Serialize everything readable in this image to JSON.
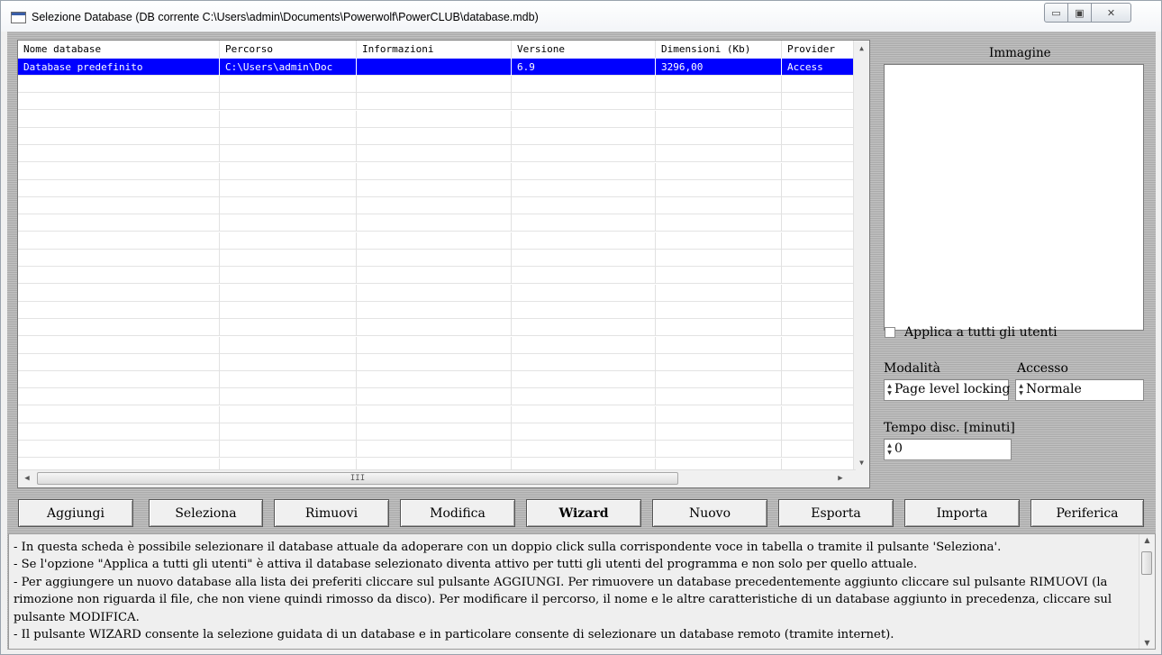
{
  "window": {
    "title": "Selezione Database (DB corrente C:\\Users\\admin\\Documents\\Powerwolf\\PowerCLUB\\database.mdb)",
    "minimize_glyph": "▭",
    "maximize_glyph": "▣",
    "close_glyph": "✕"
  },
  "grid": {
    "columns": [
      "Nome database",
      "Percorso",
      "Informazioni",
      "Versione",
      "Dimensioni (Kb)",
      "Provider"
    ],
    "rows": [
      {
        "name": "Database predefinito",
        "path": "C:\\Users\\admin\\Doc",
        "info": "",
        "version": "6.9",
        "size": "3296,00",
        "provider": "Access",
        "selected": true
      }
    ],
    "scroll_up": "▲",
    "scroll_down": "▼",
    "scroll_left": "◀",
    "scroll_right": "▶",
    "hthumb_grip": "III"
  },
  "panel": {
    "image_label": "Immagine",
    "apply_all_label": "Applica a tutti gli utenti",
    "apply_all_checked": false,
    "modalita_label": "Modalità",
    "modalita_value": "Page level locking",
    "accesso_label": "Accesso",
    "accesso_value": "Normale",
    "tempo_label": "Tempo disc. [minuti]",
    "tempo_value": "0"
  },
  "buttons": [
    "Aggiungi",
    "Seleziona",
    "Rimuovi",
    "Modifica",
    "Wizard",
    "Nuovo",
    "Esporta",
    "Importa",
    "Periferica"
  ],
  "info": {
    "lines": [
      "- In questa scheda è possibile selezionare il database attuale da adoperare con  un doppio click sulla corrispondente voce in tabella o tramite il pulsante 'Seleziona'.",
      "- Se l'opzione \"Applica a tutti gli utenti\" è attiva il database selezionato diventa attivo per tutti gli utenti del programma e non solo per quello attuale.",
      "- Per aggiungere un nuovo database alla lista dei preferiti cliccare sul pulsante AGGIUNGI. Per rimuovere un database precedentemente aggiunto cliccare sul pulsante RIMUOVI (la rimozione non riguarda il file, che non viene quindi rimosso da disco). Per modificare il percorso, il nome e le altre caratteristiche di un database aggiunto in precedenza, cliccare sul pulsante MODIFICA.",
      "- Il pulsante WIZARD consente la selezione guidata di un database e in particolare consente di selezionare un database remoto (tramite internet)."
    ]
  },
  "colors": {
    "selection": "#0000ff",
    "panel_bg": "#b5b5b5"
  }
}
